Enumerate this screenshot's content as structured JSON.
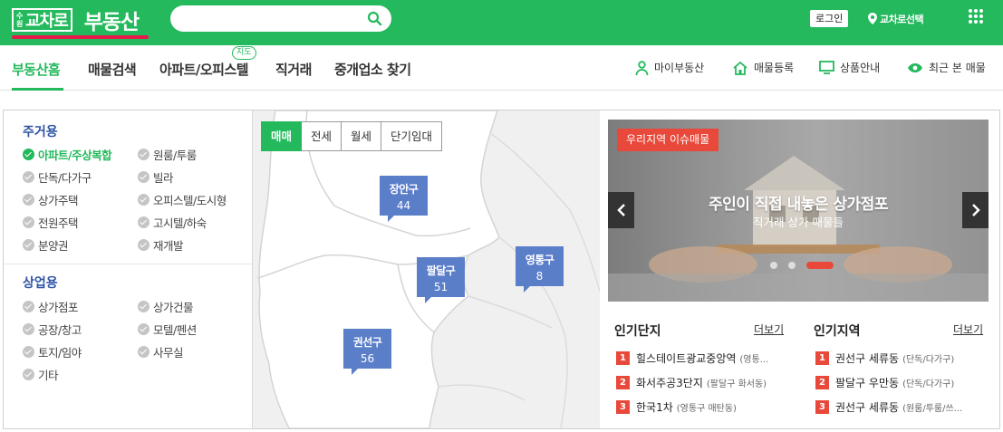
{
  "header": {
    "logo_sub": "수원",
    "logo_main": "교차로",
    "logo_name": "부동산",
    "search_placeholder": "",
    "login_label": "로그인",
    "region_label": "교차로선택"
  },
  "nav": {
    "items": [
      {
        "label": "부동산홈"
      },
      {
        "label": "매물검색"
      },
      {
        "label": "아파트/오피스텔"
      },
      {
        "label": "직거래"
      },
      {
        "label": "중개업소 찾기"
      }
    ],
    "badge": "지도",
    "utils": [
      {
        "label": "마이부동산",
        "icon": "person-icon"
      },
      {
        "label": "매물등록",
        "icon": "house-icon"
      },
      {
        "label": "상품안내",
        "icon": "monitor-icon"
      },
      {
        "label": "최근 본 매물",
        "icon": "eye-icon"
      }
    ]
  },
  "filters": {
    "residential_title": "주거용",
    "residential": [
      {
        "label": "아파트/주상복합",
        "checked": true
      },
      {
        "label": "원룸/투룸",
        "checked": false
      },
      {
        "label": "단독/다가구",
        "checked": false
      },
      {
        "label": "빌라",
        "checked": false
      },
      {
        "label": "상가주택",
        "checked": false
      },
      {
        "label": "오피스텔/도시형",
        "checked": false
      },
      {
        "label": "전원주택",
        "checked": false
      },
      {
        "label": "고시텔/하숙",
        "checked": false
      },
      {
        "label": "분양권",
        "checked": false
      },
      {
        "label": "재개발",
        "checked": false
      }
    ],
    "commercial_title": "상업용",
    "commercial": [
      {
        "label": "상가점포",
        "checked": false
      },
      {
        "label": "상가건물",
        "checked": false
      },
      {
        "label": "공장/창고",
        "checked": false
      },
      {
        "label": "모텔/펜션",
        "checked": false
      },
      {
        "label": "토지/임야",
        "checked": false
      },
      {
        "label": "사무실",
        "checked": false
      },
      {
        "label": "기타",
        "checked": false
      }
    ]
  },
  "map": {
    "tabs": [
      {
        "label": "매매",
        "active": true
      },
      {
        "label": "전세",
        "active": false
      },
      {
        "label": "월세",
        "active": false
      },
      {
        "label": "단기임대",
        "active": false
      }
    ],
    "markers": [
      {
        "name": "장안구",
        "count": "44"
      },
      {
        "name": "팔달구",
        "count": "51"
      },
      {
        "name": "영통구",
        "count": "8"
      },
      {
        "name": "권선구",
        "count": "56"
      }
    ]
  },
  "banner": {
    "tag": "우리지역 이슈매물",
    "title": "주인이 직접 내놓은 상가점포",
    "subtitle": "직거래 상가 매물들",
    "slide_count": 3,
    "active_slide": 3
  },
  "popular_complex": {
    "title": "인기단지",
    "more": "더보기",
    "items": [
      {
        "rank": "1",
        "name": "힐스테이트광교중앙역",
        "sub": "(영통..."
      },
      {
        "rank": "2",
        "name": "화서주공3단지",
        "sub": "(팔달구 화서동)"
      },
      {
        "rank": "3",
        "name": "한국1차",
        "sub": "(영통구 매탄동)"
      }
    ]
  },
  "popular_region": {
    "title": "인기지역",
    "more": "더보기",
    "items": [
      {
        "rank": "1",
        "name": "권선구 세류동",
        "sub": "(단독/다가구)"
      },
      {
        "rank": "2",
        "name": "팔달구 우만동",
        "sub": "(단독/다가구)"
      },
      {
        "rank": "3",
        "name": "권선구 세류동",
        "sub": "(원룸/투룸/쓰..."
      }
    ]
  },
  "colors": {
    "brand": "#23b95c",
    "accent": "#e8493a",
    "marker": "#5b7ec9",
    "section_title": "#2e53a5"
  }
}
